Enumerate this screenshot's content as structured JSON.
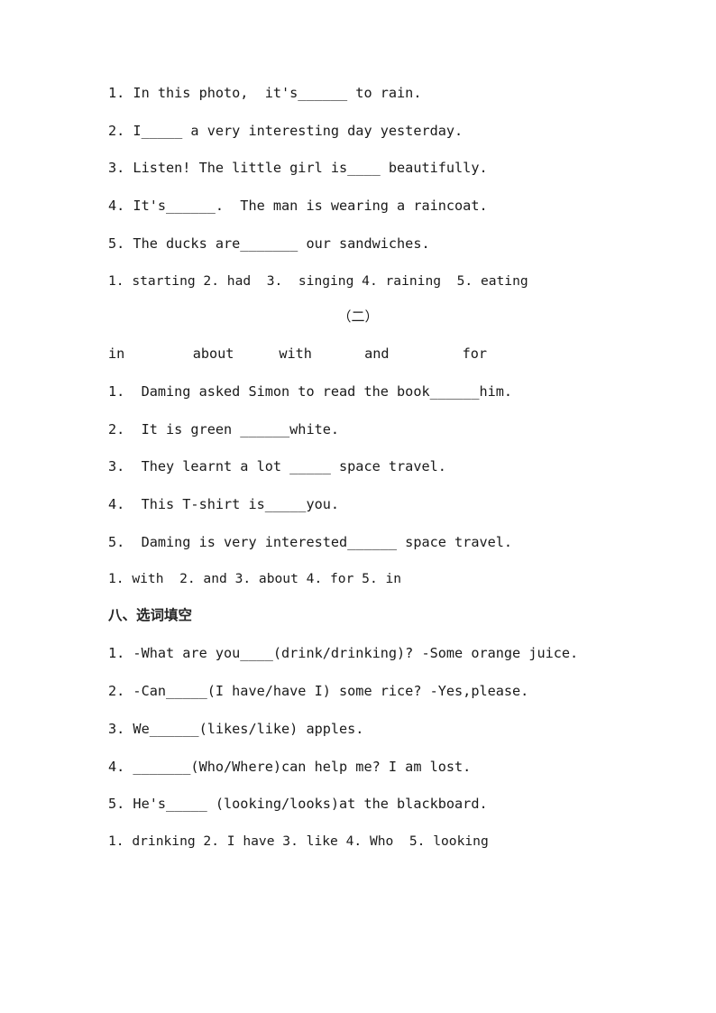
{
  "document": {
    "page_background": "#ffffff",
    "text_color": "#1a1a1a"
  },
  "section_one": {
    "questions": [
      "1. In this photo,  it's______ to rain.",
      "2. I_____ a very interesting day yesterday.",
      "3. Listen! The little girl is____ beautifully.",
      "4. It's______.  The man is wearing a raincoat.",
      "5. The ducks are_______ our sandwiches."
    ],
    "answer_key": "1. starting 2. had  3.  singing 4. raining  5. eating"
  },
  "part_two": {
    "marker": "（二）",
    "word_bank": {
      "words": [
        "in",
        "about",
        "with",
        "and",
        "for"
      ]
    },
    "questions": [
      "1.  Daming asked Simon to read the book______him.",
      "2.  It is green ______white.",
      "3.  They learnt a lot _____ space travel.",
      "4.  This T-shirt is_____you.",
      "5.  Daming is very interested______ space travel."
    ],
    "answer_key": "1. with  2. and 3. about 4. for 5. in"
  },
  "section_eight": {
    "heading": "八、选词填空",
    "questions": [
      "1. -What are you____(drink/drinking)? -Some orange juice.",
      "2. -Can_____(I have/have I) some rice? -Yes,please.",
      "3. We______(likes/like) apples.",
      "4. _______(Who/Where)can help me? I am lost.",
      "5. He's_____ (looking/looks)at the blackboard."
    ],
    "answer_key": "1. drinking 2. I have 3. like 4. Who  5. looking"
  }
}
